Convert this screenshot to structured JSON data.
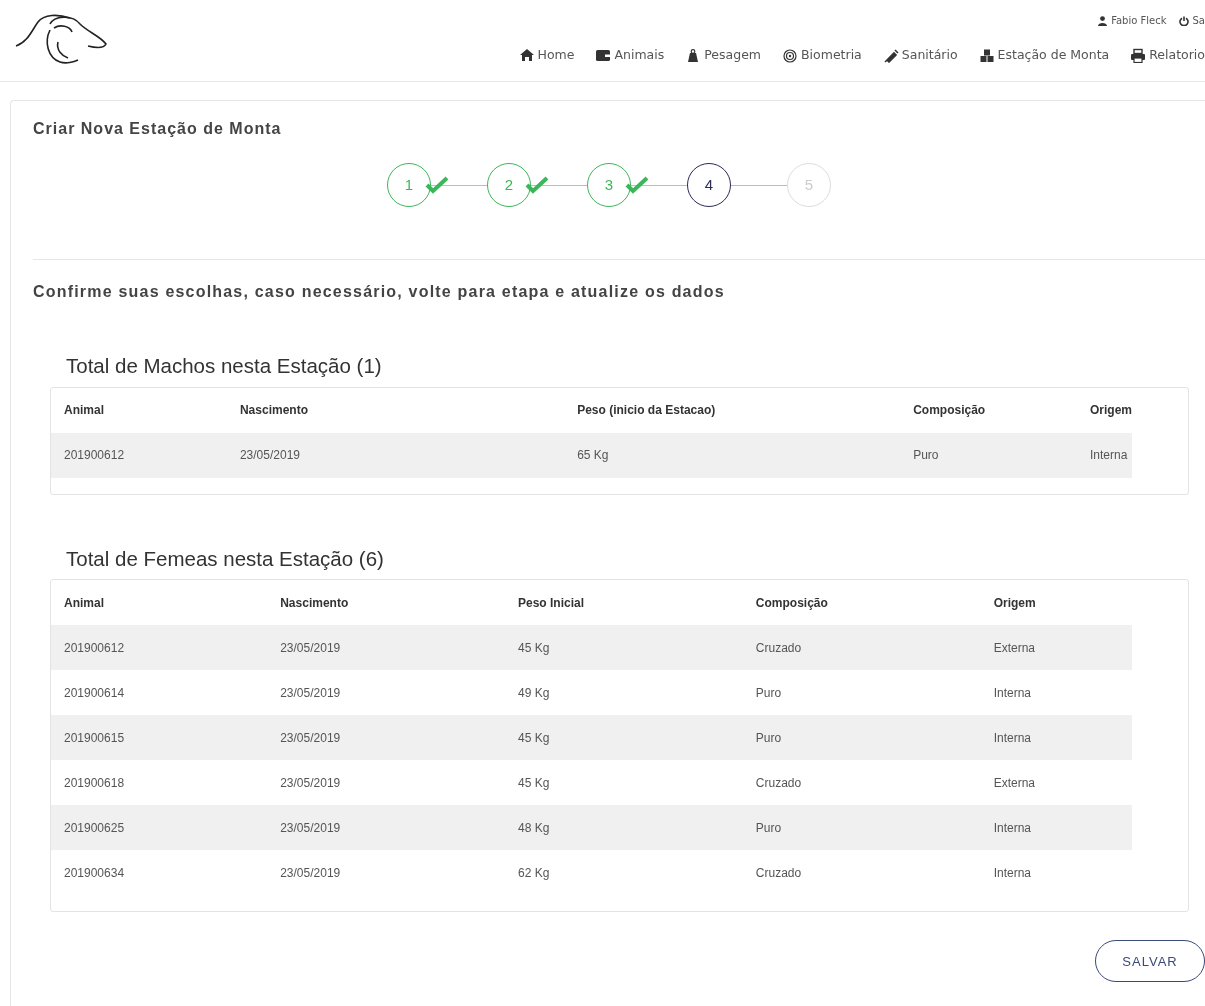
{
  "header": {
    "user": "Fabio Fleck",
    "logout": "Sa",
    "nav": [
      {
        "label": "Home"
      },
      {
        "label": "Animais"
      },
      {
        "label": "Pesagem"
      },
      {
        "label": "Biometria"
      },
      {
        "label": "Sanitário"
      },
      {
        "label": "Estação de Monta"
      },
      {
        "label": "Relatorio"
      }
    ]
  },
  "title": "Criar Nova Estação de Monta",
  "steps": [
    {
      "label": "1",
      "completed": true,
      "selected": false
    },
    {
      "label": "2",
      "completed": true,
      "selected": false
    },
    {
      "label": "3",
      "completed": true,
      "selected": false
    },
    {
      "label": "4",
      "completed": false,
      "selected": true
    },
    {
      "label": "5",
      "completed": false,
      "selected": false
    }
  ],
  "instruction": "Confirme suas escolhas, caso necessário, volte para etapa e atualize os dados",
  "tables": [
    {
      "heading": "Total de Machos nesta Estação (1)",
      "columns": [
        "Animal",
        "Nascimento",
        "Peso (inicio da Estacao)",
        "Composição",
        "Origem"
      ],
      "rows": [
        [
          "201900612",
          "23/05/2019",
          "65 Kg",
          "Puro",
          "Interna"
        ]
      ]
    },
    {
      "heading": "Total de Femeas nesta Estação (6)",
      "columns": [
        "Animal",
        "Nascimento",
        "Peso Inicial",
        "Composição",
        "Origem"
      ],
      "rows": [
        [
          "201900612",
          "23/05/2019",
          "45 Kg",
          "Cruzado",
          "Externa"
        ],
        [
          "201900614",
          "23/05/2019",
          "49 Kg",
          "Puro",
          "Interna"
        ],
        [
          "201900615",
          "23/05/2019",
          "45 Kg",
          "Puro",
          "Interna"
        ],
        [
          "201900618",
          "23/05/2019",
          "45 Kg",
          "Cruzado",
          "Externa"
        ],
        [
          "201900625",
          "23/05/2019",
          "48 Kg",
          "Puro",
          "Interna"
        ],
        [
          "201900634",
          "23/05/2019",
          "62 Kg",
          "Cruzado",
          "Interna"
        ]
      ]
    }
  ],
  "save_button": "SALVAR"
}
